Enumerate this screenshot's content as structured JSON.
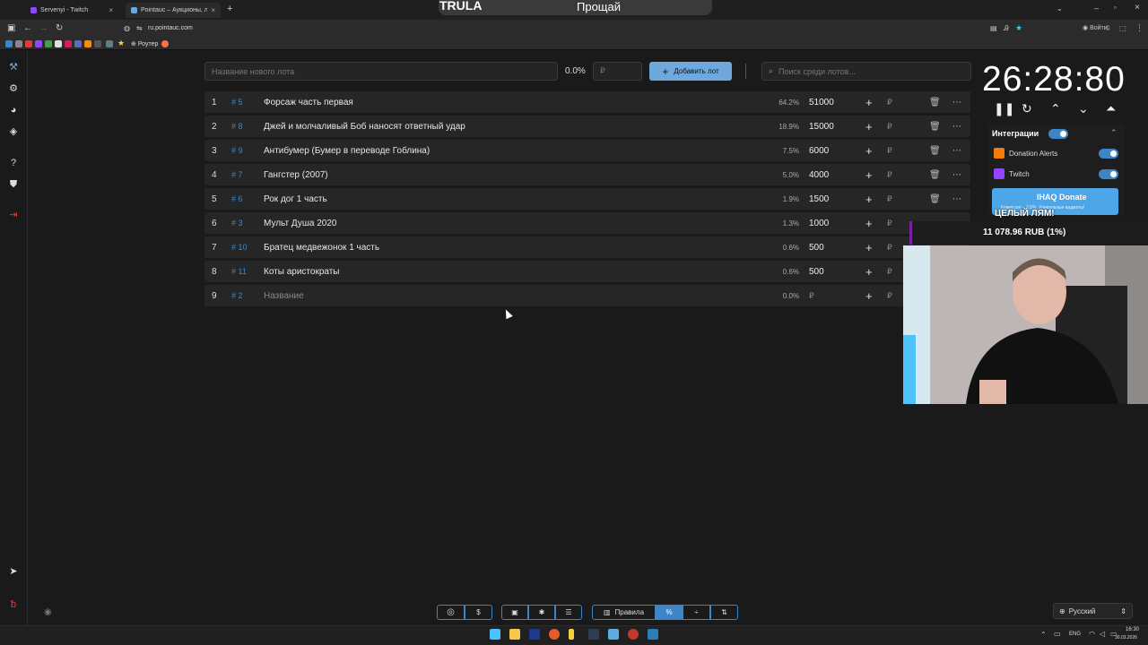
{
  "browser": {
    "tabs": [
      {
        "title": "Servenyi - Twitch",
        "active": false
      },
      {
        "title": "Pointauc – Аукционы, лотере",
        "active": true
      }
    ],
    "url": "ru.pointauc.com",
    "bookmark_router": "Роутер",
    "login_label": "Войти"
  },
  "overlay": {
    "trula": "TRULA",
    "song": "Прощай",
    "goal": "ЦЕЛЫЙ ЛЯМ!",
    "goal_amount": "11 078.96 RUB (1%)"
  },
  "toolbar": {
    "new_lot_placeholder": "Название нового лота",
    "percent": "0.0%",
    "amount_placeholder": "₽",
    "add_lot_label": "Добавить лот",
    "search_placeholder": "Поиск среди лотов..."
  },
  "lots": [
    {
      "num": "1",
      "id": "# 5",
      "name": "Форсаж часть первая",
      "percent": "64.2%",
      "amount": "51000"
    },
    {
      "num": "2",
      "id": "# 8",
      "name": "Джей и молчаливый Боб наносят ответный удар",
      "percent": "18.9%",
      "amount": "15000"
    },
    {
      "num": "3",
      "id": "# 9",
      "name": "Антибумер (Бумер в переводе Гоблина)",
      "percent": "7.5%",
      "amount": "6000"
    },
    {
      "num": "4",
      "id": "# 7",
      "name": "Гангстер (2007)",
      "percent": "5.0%",
      "amount": "4000"
    },
    {
      "num": "5",
      "id": "# 6",
      "name": "Рок дог 1 часть",
      "percent": "1.9%",
      "amount": "1500"
    },
    {
      "num": "6",
      "id": "# 3",
      "name": "Мульт Душа 2020",
      "percent": "1.3%",
      "amount": "1000"
    },
    {
      "num": "7",
      "id": "# 10",
      "name": "Братец медвежонок 1 часть",
      "percent": "0.6%",
      "amount": "500"
    },
    {
      "num": "8",
      "id": "# 11",
      "name": "Коты аристократы",
      "percent": "0.6%",
      "amount": "500"
    },
    {
      "num": "9",
      "id": "# 2",
      "name": "Название",
      "percent": "0.0%",
      "amount": "₽"
    }
  ],
  "row_actions": {
    "plus": "+",
    "ruble": "₽",
    "trash": "🗑",
    "more": "⋯"
  },
  "timer": {
    "value": "26:28:80"
  },
  "integrations": {
    "title": "Интеграции",
    "items": [
      "Donation Alerts",
      "Twitch"
    ],
    "donate_label": "IHAQ Donate",
    "donate_sub": "Комиссия – 3.5%. Уникальные виджеты!"
  },
  "bottom": {
    "rules_label": "Правила",
    "language": "Русский"
  },
  "taskbar": {
    "lang": "ENG",
    "time": "16:30",
    "date": "30.03.2026"
  },
  "colors": {
    "accent": "#3d85c6",
    "button": "#6fa8dc",
    "twitch": "#9146ff"
  }
}
